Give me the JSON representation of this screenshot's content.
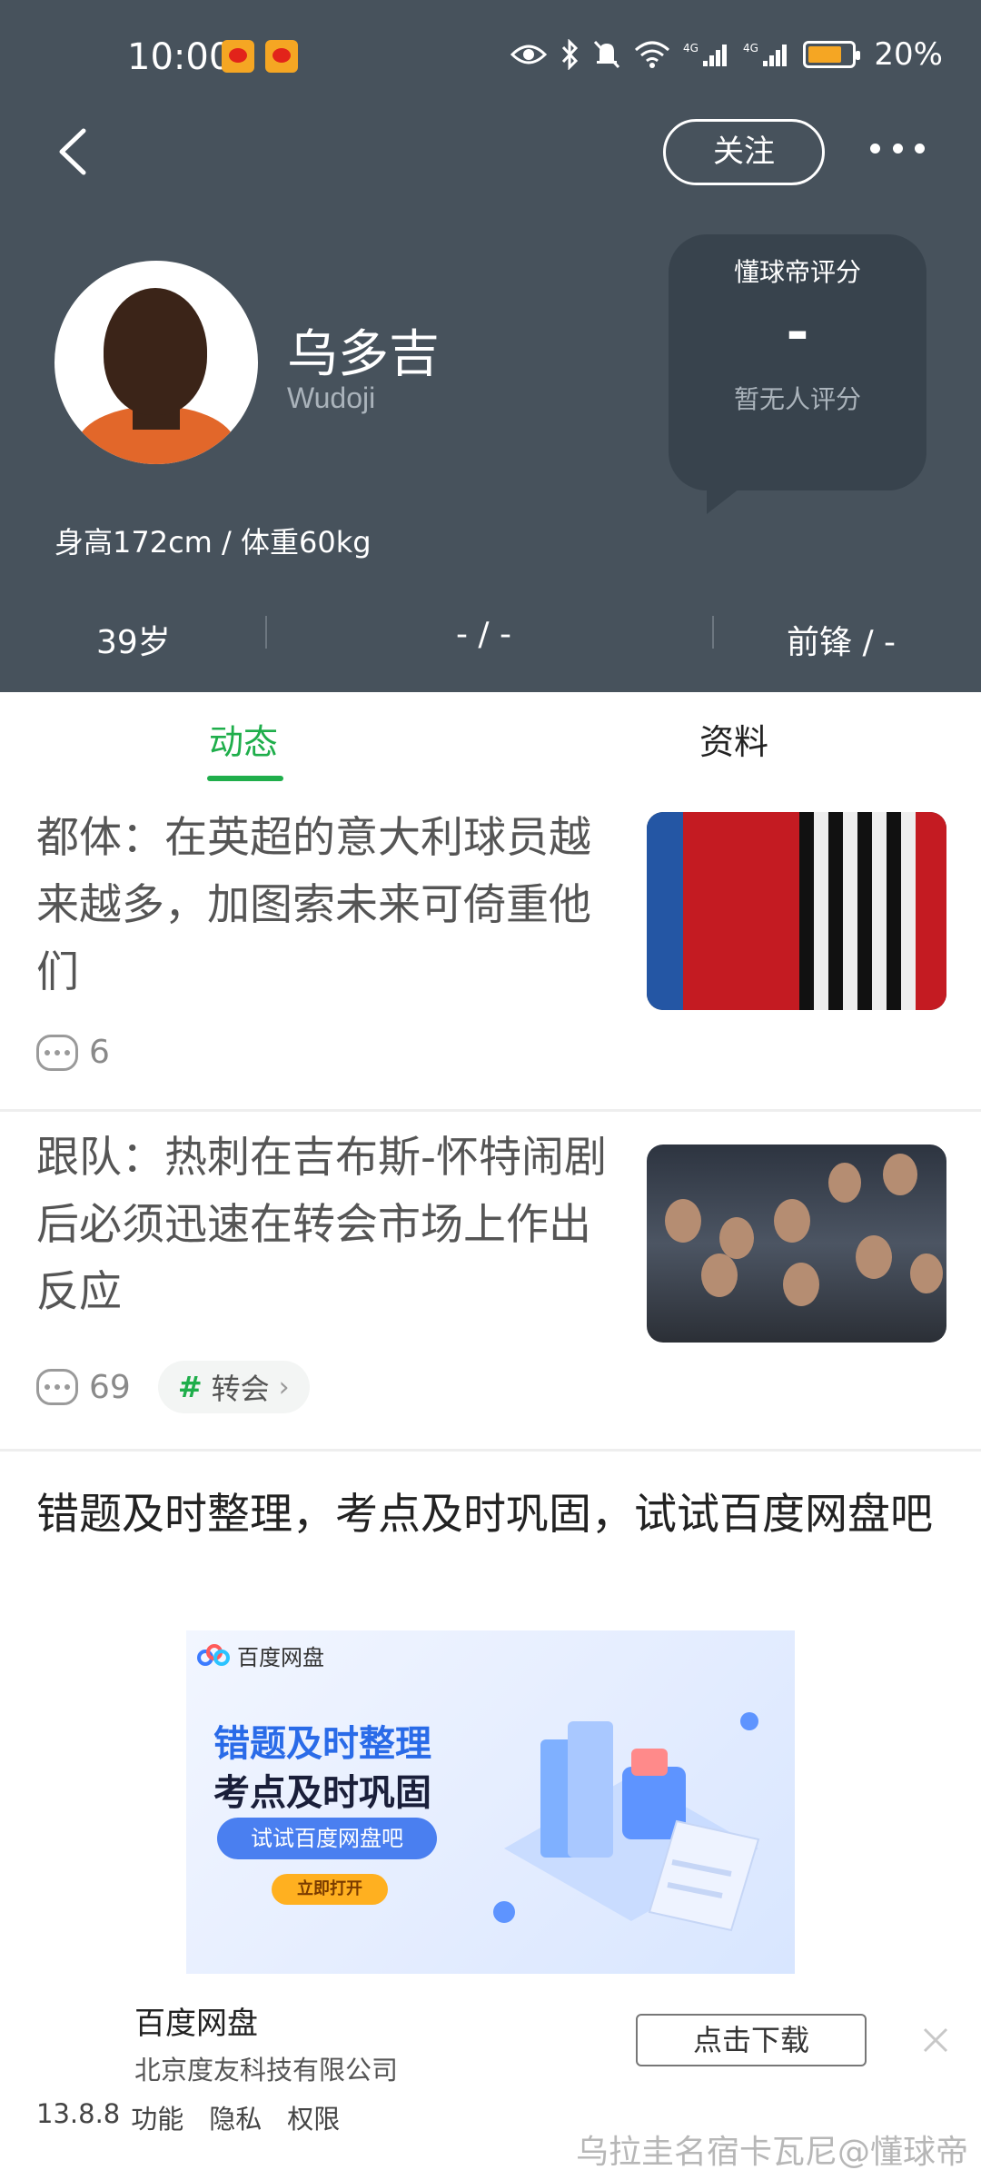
{
  "status_bar": {
    "time": "10:00",
    "battery": "20%",
    "icons": [
      "eye-icon",
      "bluetooth-icon",
      "mute-icon",
      "wifi-icon",
      "signal-4g-icon",
      "signal-4g-icon",
      "battery-icon"
    ]
  },
  "nav": {
    "follow_label": "关注"
  },
  "player": {
    "name": "乌多吉",
    "name_en": "Wudoji",
    "body_info": "身高172cm / 体重60kg"
  },
  "rating": {
    "title": "懂球帝评分",
    "value": "-",
    "sub": "暂无人评分"
  },
  "stats": {
    "age": "39岁",
    "club": "- / -",
    "position": "前锋 / -"
  },
  "tabs": [
    {
      "label": "动态",
      "active": true
    },
    {
      "label": "资料",
      "active": false
    }
  ],
  "news": [
    {
      "title": "都体：在英超的意大利球员越来越多，加图索未来可倚重他们",
      "comments": "6",
      "tag": ""
    },
    {
      "title": "跟队：热刺在吉布斯-怀特闹剧后必须迅速在转会市场上作出反应",
      "comments": "69",
      "tag": "转会"
    }
  ],
  "ad": {
    "title": "错题及时整理，考点及时巩固，试试百度网盘吧",
    "banner": {
      "brand": "百度网盘",
      "line1": "错题及时整理",
      "line2": "考点及时巩固",
      "pill": "试试百度网盘吧",
      "open": "立即打开"
    },
    "app_name": "百度网盘",
    "company": "北京度友科技有限公司",
    "version": "13.8.8",
    "links": [
      "功能",
      "隐私",
      "权限"
    ],
    "download_label": "点击下载"
  },
  "watermark": "乌拉圭名宿卡瓦尼@懂球帝",
  "colors": {
    "header_bg": "#47525c",
    "accent": "#1fae4b"
  }
}
